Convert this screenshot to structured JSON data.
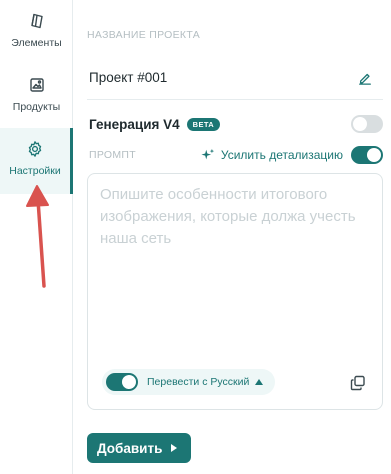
{
  "sidebar": {
    "items": [
      {
        "label": "Элементы",
        "icon": "cube-icon",
        "active": false
      },
      {
        "label": "Продукты",
        "icon": "image-icon",
        "active": false
      },
      {
        "label": "Настройки",
        "icon": "gear-icon",
        "active": true
      }
    ]
  },
  "project": {
    "section_label": "НАЗВАНИЕ ПРОЕКТА",
    "name": "Проект #001"
  },
  "generation": {
    "title": "Генерация V4",
    "badge": "BETA",
    "enabled": false
  },
  "prompt": {
    "label": "ПРОМПТ",
    "enhance_label": "Усилить детализацию",
    "enhance_enabled": true,
    "placeholder": "Опишите особенности итогового изображения, которые должа учесть наша сеть",
    "translate_label": "Перевести с Русский",
    "translate_enabled": true
  },
  "actions": {
    "add_label": "Добавить"
  },
  "colors": {
    "accent": "#1c7674",
    "annotation_arrow": "#d9534f"
  }
}
